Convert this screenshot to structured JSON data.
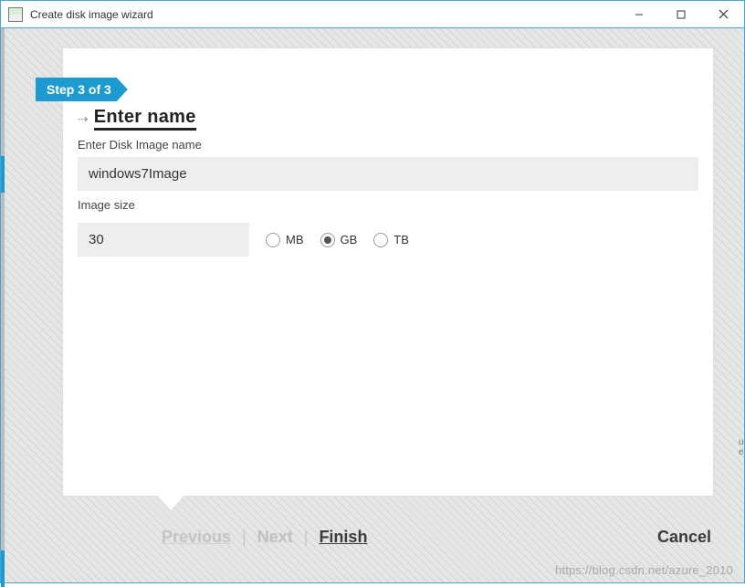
{
  "window": {
    "title": "Create disk image wizard"
  },
  "wizard": {
    "step_label": "Step 3 of 3",
    "heading": "Enter name",
    "name_label": "Enter Disk Image name",
    "name_value": "windows7Image",
    "size_label": "Image size",
    "size_value": "30",
    "units": {
      "mb": "MB",
      "gb": "GB",
      "tb": "TB",
      "selected": "gb"
    }
  },
  "footer": {
    "previous": "Previous",
    "next": "Next",
    "finish": "Finish",
    "cancel": "Cancel"
  },
  "watermark": "https://blog.csdn.net/azure_2010"
}
